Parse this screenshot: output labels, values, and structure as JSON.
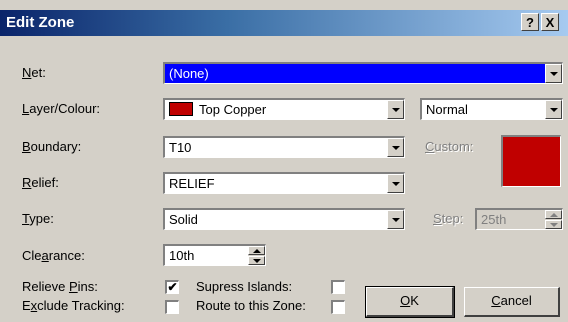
{
  "window": {
    "title": "Edit Zone",
    "help_label": "?",
    "close_label": "X"
  },
  "net": {
    "label_pre": "",
    "label_key": "N",
    "label_post": "et:",
    "value": "(None)"
  },
  "layer": {
    "label_pre": "",
    "label_key": "L",
    "label_post": "ayer/Colour:",
    "value": "Top Copper",
    "swatch_color": "#c00000",
    "mode_value": "Normal"
  },
  "boundary": {
    "label_pre": "",
    "label_key": "B",
    "label_post": "oundary:",
    "value": "T10"
  },
  "custom": {
    "label_pre": "",
    "label_key": "C",
    "label_post": "ustom:",
    "color": "#c00000"
  },
  "relief": {
    "label_pre": "",
    "label_key": "R",
    "label_post": "elief:",
    "value": "RELIEF"
  },
  "type": {
    "label_pre": "",
    "label_key": "T",
    "label_post": "ype:",
    "value": "Solid"
  },
  "step": {
    "label_pre": "",
    "label_key": "S",
    "label_post": "tep:",
    "value": "25th"
  },
  "clearance": {
    "label_pre": "Cle",
    "label_key": "a",
    "label_post": "rance:",
    "value": "10th"
  },
  "relieve_pins": {
    "label_pre": "Relieve ",
    "label_key": "P",
    "label_post": "ins:",
    "checked": true,
    "mark": "✔"
  },
  "supress_islands": {
    "label": "Supress Islands:",
    "checked": false
  },
  "exclude_tracking": {
    "label_pre": "E",
    "label_key": "x",
    "label_post": "clude Tracking:",
    "checked": false
  },
  "route_to_zone": {
    "label": "Route to this Zone:",
    "checked": false
  },
  "buttons": {
    "ok_key": "O",
    "ok_rest": "K",
    "cancel_key": "C",
    "cancel_rest": "ancel"
  }
}
